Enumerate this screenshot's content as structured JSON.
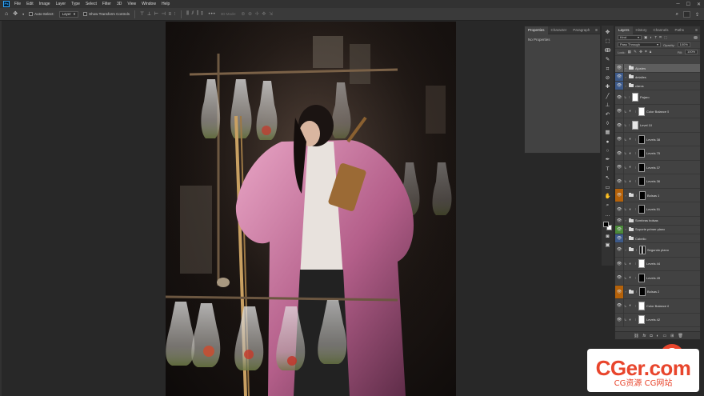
{
  "menu": {
    "app_icon": "Ps",
    "items": [
      "File",
      "Edit",
      "Image",
      "Layer",
      "Type",
      "Select",
      "Filter",
      "3D",
      "View",
      "Window",
      "Help"
    ],
    "window_controls": [
      "minimize-icon",
      "maximize-icon",
      "close-icon"
    ]
  },
  "options": {
    "auto_select_label": "Auto-Select:",
    "auto_select_target": "Layer",
    "transform_controls_label": "Show Transform Controls",
    "mode_3d_label": "3D Mode:"
  },
  "properties": {
    "tabs": [
      "Properties",
      "Character",
      "Paragraph"
    ],
    "empty_text": "No Properties"
  },
  "layers_panel": {
    "tabs": [
      "Layers",
      "History",
      "Channels",
      "Paths"
    ],
    "filter_kind": "Kind",
    "blend_mode": "Pass Through",
    "opacity_label": "Opacity:",
    "opacity_value": "100%",
    "lock_label": "Lock:",
    "fill_label": "Fill:",
    "fill_value": "100%",
    "layers": [
      {
        "name": "Ajustes",
        "kind": "group",
        "eye": "",
        "selected": true,
        "tall": false
      },
      {
        "name": "detalles",
        "kind": "group",
        "eye": "blue",
        "tall": false
      },
      {
        "name": "claros",
        "kind": "group",
        "eye": "blue",
        "tall": false
      },
      {
        "name": "Pajaro",
        "kind": "layer",
        "thumb": "white",
        "eye": "",
        "tall": true
      },
      {
        "name": "Color Balance 5",
        "kind": "adjustment",
        "thumb": "white",
        "eye": "",
        "tall": true
      },
      {
        "name": "Level 10",
        "kind": "layer",
        "thumb": "pale",
        "eye": "",
        "tall": true
      },
      {
        "name": "Levels 38",
        "kind": "adjustment",
        "thumb": "black",
        "eye": "",
        "tall": true
      },
      {
        "name": "Levels 75",
        "kind": "adjustment",
        "thumb": "black",
        "eye": "",
        "tall": true
      },
      {
        "name": "Levels 37",
        "kind": "adjustment",
        "thumb": "black",
        "eye": "",
        "tall": true
      },
      {
        "name": "Levels 36",
        "kind": "adjustment",
        "thumb": "black",
        "eye": "",
        "tall": true
      },
      {
        "name": "Bolsas 1",
        "kind": "group-masked",
        "thumb": "black",
        "eye": "orange",
        "tall": true,
        "underline": true
      },
      {
        "name": "Levels 51",
        "kind": "adjustment",
        "thumb": "black",
        "eye": "",
        "tall": true
      },
      {
        "name": "Sombras bolsas",
        "kind": "group",
        "eye": "",
        "tall": false
      },
      {
        "name": "Soporte primer plano",
        "kind": "group",
        "eye": "green",
        "tall": false
      },
      {
        "name": "Cabello",
        "kind": "group",
        "eye": "blue",
        "tall": false
      },
      {
        "name": "Segundo plano",
        "kind": "group-masked",
        "thumb": "sil",
        "eye": "",
        "tall": true
      },
      {
        "name": "Levels 44",
        "kind": "adjustment",
        "thumb": "white",
        "eye": "",
        "tall": true
      },
      {
        "name": "Levels 49",
        "kind": "adjustment",
        "thumb": "black",
        "eye": "",
        "tall": true
      },
      {
        "name": "Bolsas 2",
        "kind": "group-masked",
        "thumb": "black",
        "eye": "orange",
        "tall": true,
        "underline": true
      },
      {
        "name": "Color Balance 6",
        "kind": "adjustment",
        "thumb": "white",
        "eye": "",
        "tall": true
      },
      {
        "name": "Levels 42",
        "kind": "adjustment",
        "thumb": "white",
        "eye": "",
        "tall": true
      }
    ],
    "footer_icons": [
      "link-icon",
      "fx-icon",
      "mask-icon",
      "adjustment-icon",
      "folder-icon",
      "new-layer-icon",
      "trash-icon"
    ]
  },
  "right_toolbar_icons": [
    "move-icon",
    "marquee-icon",
    "lasso-icon",
    "quick-select-icon",
    "crop-icon",
    "eyedropper-icon",
    "healing-icon",
    "brush-icon",
    "stamp-icon",
    "history-brush-icon",
    "eraser-icon",
    "gradient-icon",
    "blur-icon",
    "dodge-icon",
    "pen-icon",
    "type-icon",
    "path-select-icon",
    "rectangle-icon",
    "hand-icon",
    "zoom-icon",
    "more-icon"
  ],
  "watermark": {
    "brand": "CGer.com",
    "subtitle": "CG资源 CG网站"
  },
  "colors": {
    "label_blue": "#3d5a8a",
    "label_green": "#4b8a3a",
    "label_orange": "#b5620a",
    "watermark_red": "#e8452c"
  }
}
